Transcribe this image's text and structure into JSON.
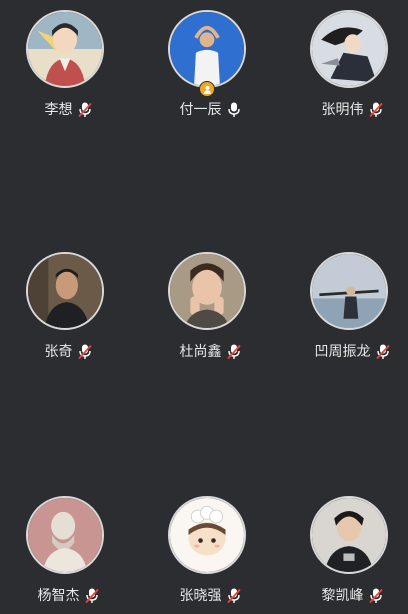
{
  "participants": [
    {
      "name": "李想",
      "mic": "muted",
      "avatar": "cartoon-portrait"
    },
    {
      "name": "付一辰",
      "mic": "on",
      "host": true,
      "avatar": "photo-sky"
    },
    {
      "name": "张明伟",
      "mic": "muted",
      "avatar": "illustration"
    },
    {
      "name": "张奇",
      "mic": "muted",
      "avatar": "photo-portrait"
    },
    {
      "name": "杜尚鑫",
      "mic": "muted",
      "avatar": "photo-portrait"
    },
    {
      "name": "凹周振龙",
      "mic": "muted",
      "avatar": "photo-sea"
    },
    {
      "name": "杨智杰",
      "mic": "muted",
      "avatar": "statue"
    },
    {
      "name": "张晓强",
      "mic": "muted",
      "avatar": "cartoon-baby"
    },
    {
      "name": "黎凯峰",
      "mic": "muted",
      "avatar": "photo-portrait"
    }
  ],
  "colors": {
    "background": "#2b2d31",
    "muted_mic": "#e0483b",
    "host_badge": "#f2a81d"
  },
  "icons": {
    "mic_on": "microphone-icon",
    "mic_muted": "microphone-muted-icon",
    "host": "host-person-icon"
  }
}
